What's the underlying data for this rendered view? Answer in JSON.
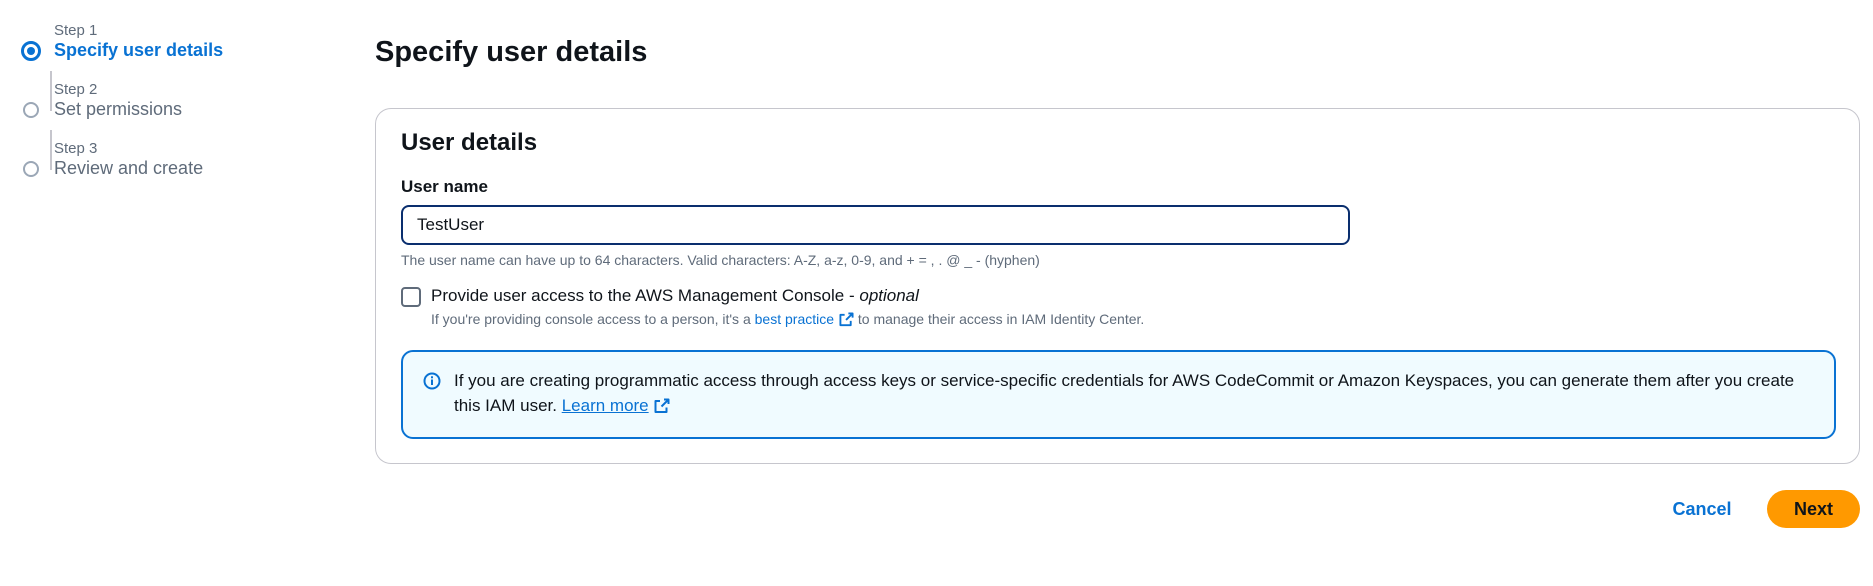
{
  "wizard": {
    "steps": [
      {
        "number": "Step 1",
        "title": "Specify user details",
        "state": "active"
      },
      {
        "number": "Step 2",
        "title": "Set permissions",
        "state": "inactive"
      },
      {
        "number": "Step 3",
        "title": "Review and create",
        "state": "inactive"
      }
    ]
  },
  "main": {
    "page_title": "Specify user details",
    "section_title": "User details",
    "user_name": {
      "label": "User name",
      "value": "TestUser",
      "hint": "The user name can have up to 64 characters. Valid characters: A-Z, a-z, 0-9, and + = , . @ _ - (hyphen)"
    },
    "console_access": {
      "label": "Provide user access to the AWS Management Console - ",
      "label_optional": "optional",
      "checked": false,
      "desc_before": "If you're providing console access to a person, it's a ",
      "desc_link": "best practice",
      "desc_after": " to manage their access in IAM Identity Center."
    },
    "info_alert": {
      "text": "If you are creating programmatic access through access keys or service-specific credentials for AWS CodeCommit or Amazon Keyspaces, you can generate them after you create this IAM user. ",
      "link": "Learn more"
    }
  },
  "actions": {
    "cancel_label": "Cancel",
    "next_label": "Next"
  },
  "icons": {
    "external_link": "external-link-icon",
    "info": "info-icon"
  },
  "colors": {
    "accent": "#0972d3",
    "primary_button": "#ff9900",
    "input_focus_border": "#0a2e6e",
    "info_background": "#f0fbff"
  }
}
